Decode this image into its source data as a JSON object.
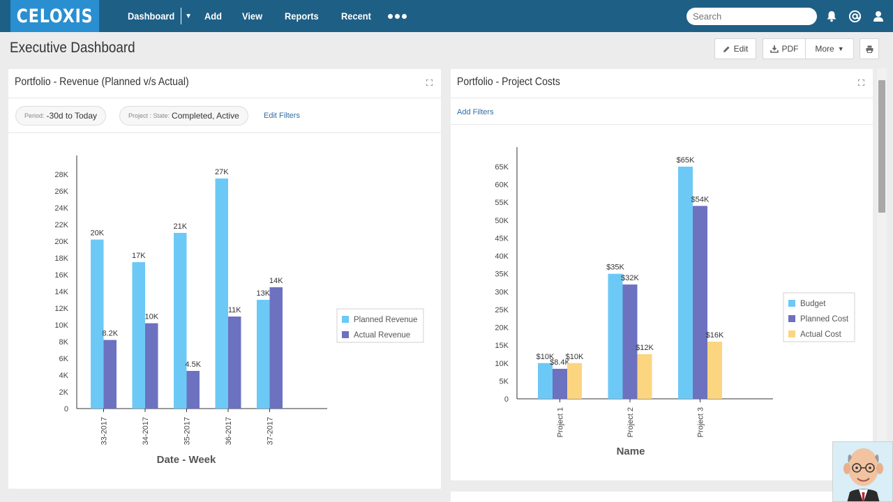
{
  "app": {
    "logo": "CELOXIS",
    "nav": [
      {
        "label": "Dashboard"
      },
      {
        "label": "Add"
      },
      {
        "label": "View"
      },
      {
        "label": "Reports"
      },
      {
        "label": "Recent"
      }
    ],
    "search_placeholder": "Search"
  },
  "page": {
    "title": "Executive Dashboard",
    "buttons": {
      "edit": "Edit",
      "pdf": "PDF",
      "more": "More"
    }
  },
  "revenue_panel": {
    "title": "Portfolio - Revenue (Planned v/s Actual)",
    "filters": [
      {
        "key": "Period:",
        "value": "-30d to Today"
      },
      {
        "key": "Project : State:",
        "value": "Completed, Active"
      }
    ],
    "edit_filters": "Edit Filters"
  },
  "costs_panel": {
    "title": "Portfolio - Project Costs",
    "add_filters": "Add Filters"
  },
  "colors": {
    "nav": "#1e5f86",
    "logo": "#2a8fd0",
    "series1": "#6cc9f5",
    "series2": "#6c71c0",
    "series3": "#fcd580"
  },
  "chart_data": [
    {
      "type": "bar",
      "categories": [
        "33-2017",
        "34-2017",
        "35-2017",
        "36-2017",
        "37-2017"
      ],
      "series": [
        {
          "name": "Planned Revenue",
          "values": [
            20200,
            17500,
            21000,
            27500,
            13000
          ],
          "labels": [
            "20K",
            "17K",
            "21K",
            "27K",
            "13K"
          ],
          "color": "#6cc9f5"
        },
        {
          "name": "Actual Revenue",
          "values": [
            8200,
            10200,
            4500,
            11000,
            14500
          ],
          "labels": [
            "8.2K",
            "10K",
            "4.5K",
            "11K",
            "14K"
          ],
          "color": "#6c71c0"
        }
      ],
      "xlabel": "Date - Week",
      "ylim": [
        0,
        28000
      ],
      "yticks": [
        "0",
        "2K",
        "4K",
        "6K",
        "8K",
        "10K",
        "12K",
        "14K",
        "16K",
        "18K",
        "20K",
        "22K",
        "24K",
        "26K",
        "28K"
      ],
      "legend": "right"
    },
    {
      "type": "bar",
      "categories": [
        "Project 1",
        "Project 2",
        "Project 3"
      ],
      "series": [
        {
          "name": "Budget",
          "values": [
            10000,
            35000,
            65000
          ],
          "labels": [
            "$10K",
            "$35K",
            "$65K"
          ],
          "color": "#6cc9f5"
        },
        {
          "name": "Planned Cost",
          "values": [
            8400,
            32000,
            54000
          ],
          "labels": [
            "$8.4K",
            "$32K",
            "$54K"
          ],
          "color": "#6c71c0"
        },
        {
          "name": "Actual Cost",
          "values": [
            10000,
            12500,
            16000
          ],
          "labels": [
            "$10K",
            "$12K",
            "$16K"
          ],
          "color": "#fcd580"
        }
      ],
      "xlabel": "Name",
      "ylim": [
        0,
        65000
      ],
      "yticks": [
        "0",
        "5K",
        "10K",
        "15K",
        "20K",
        "25K",
        "30K",
        "35K",
        "40K",
        "45K",
        "50K",
        "55K",
        "60K",
        "65K"
      ],
      "legend": "right"
    }
  ]
}
